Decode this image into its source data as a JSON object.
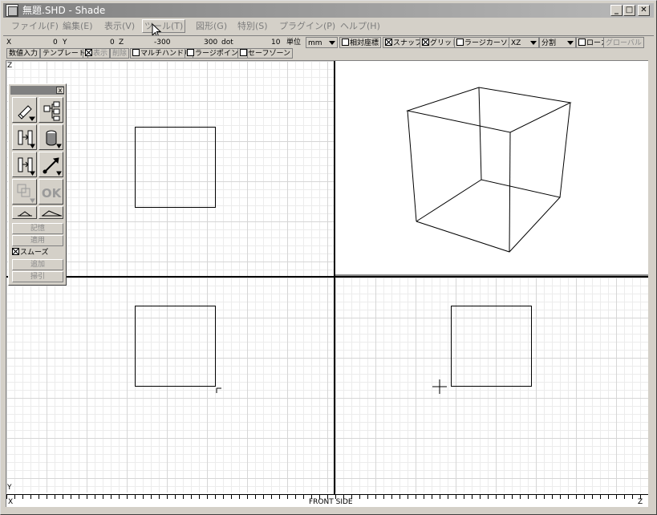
{
  "window": {
    "title": "無題.SHD - Shade",
    "minimize": "_",
    "maximize": "□",
    "close": "✕"
  },
  "menu": [
    {
      "label": "ファイル(F)"
    },
    {
      "label": "編集(E)"
    },
    {
      "label": "表示(V)"
    },
    {
      "label": "ツール(T)"
    },
    {
      "label": "図形(G)"
    },
    {
      "label": "特別(S)"
    },
    {
      "label": "プラグイン(P)"
    },
    {
      "label": "ヘルプ(H)"
    }
  ],
  "coords": {
    "x_label": "X",
    "x_value": "0",
    "y_label": "Y",
    "y_value": "0",
    "z_label": "Z",
    "z_value": "-300",
    "dot_value": "300",
    "dot_label": "dot",
    "dot_step": "10",
    "unit_label": "単位",
    "unit_value": "mm",
    "relative": "相対座標",
    "snap": "スナップ",
    "grid": "グリッド",
    "large_cursor": "ラージカーソル",
    "plane": "XZ",
    "split": "分割",
    "local": "ローカル",
    "global": "グローバル"
  },
  "options": {
    "numeric_input": "数値入力",
    "template": "テンプレート",
    "show": "表示",
    "delete": "削除",
    "multi_handle": "マルチハンドル",
    "large_point": "ラージポイント",
    "safe_zone": "セーフゾーン"
  },
  "tool_panel": {
    "close": "x",
    "memory": "記憶",
    "apply": "適用",
    "smooth": "スムーズ",
    "add": "追加",
    "sweep": "掃引",
    "ok_label": "OK"
  },
  "rulers": {
    "left_top_marker": "Z",
    "left_bottom_marker": "Y",
    "bottom_left": "X",
    "bottom_center": "FRONT SIDE",
    "bottom_right": "Z"
  }
}
